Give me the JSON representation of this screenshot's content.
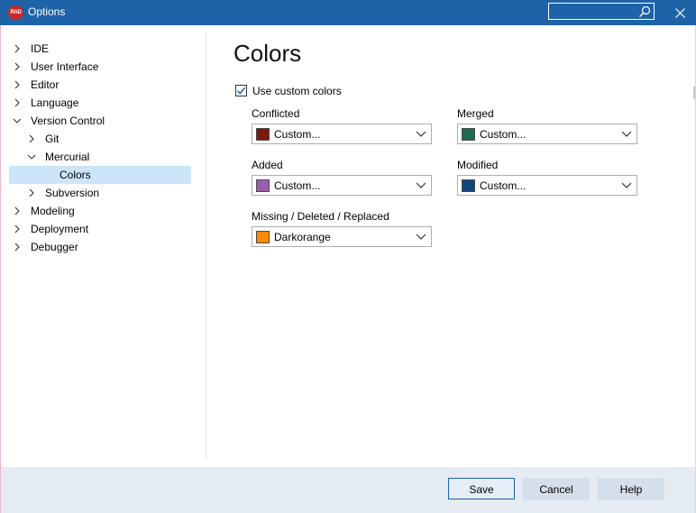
{
  "window": {
    "title": "Options",
    "app_icon_text": "RAD",
    "search_placeholder": "",
    "accent_color": "#1e62a8"
  },
  "tree": {
    "items": [
      {
        "label": "IDE",
        "level": 0,
        "state": "collapsed"
      },
      {
        "label": "User Interface",
        "level": 0,
        "state": "collapsed"
      },
      {
        "label": "Editor",
        "level": 0,
        "state": "collapsed"
      },
      {
        "label": "Language",
        "level": 0,
        "state": "collapsed"
      },
      {
        "label": "Version Control",
        "level": 0,
        "state": "expanded"
      },
      {
        "label": "Git",
        "level": 1,
        "state": "collapsed"
      },
      {
        "label": "Mercurial",
        "level": 1,
        "state": "expanded"
      },
      {
        "label": "Colors",
        "level": 2,
        "state": "leaf",
        "selected": true
      },
      {
        "label": "Subversion",
        "level": 1,
        "state": "collapsed"
      },
      {
        "label": "Modeling",
        "level": 0,
        "state": "collapsed"
      },
      {
        "label": "Deployment",
        "level": 0,
        "state": "collapsed"
      },
      {
        "label": "Debugger",
        "level": 0,
        "state": "collapsed"
      }
    ]
  },
  "page": {
    "heading": "Colors",
    "use_custom_colors_label": "Use custom colors",
    "use_custom_colors_checked": true,
    "fields": {
      "conflicted": {
        "label": "Conflicted",
        "value": "Custom...",
        "color": "#7b1a0e"
      },
      "merged": {
        "label": "Merged",
        "value": "Custom...",
        "color": "#1f6b4c"
      },
      "added": {
        "label": "Added",
        "value": "Custom...",
        "color": "#9a5fab"
      },
      "modified": {
        "label": "Modified",
        "value": "Custom...",
        "color": "#12467e"
      },
      "missing": {
        "label": "Missing / Deleted / Replaced",
        "value": "Darkorange",
        "color": "#ff8c00"
      }
    }
  },
  "buttons": {
    "save": "Save",
    "cancel": "Cancel",
    "help": "Help"
  }
}
